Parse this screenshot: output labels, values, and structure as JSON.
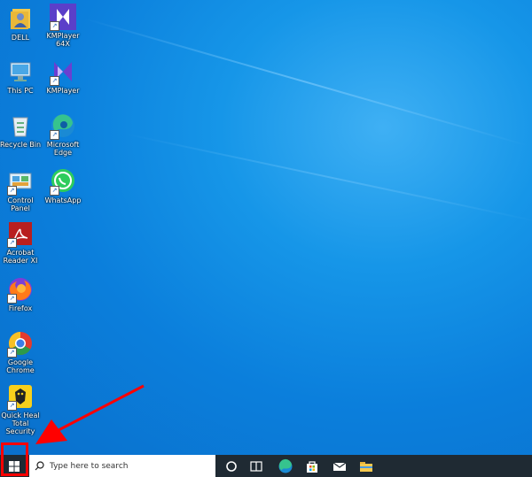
{
  "desktop": {
    "icons": [
      {
        "label": "DELL",
        "icon": "user-folder-icon"
      },
      {
        "label": "KMPlayer 64X",
        "icon": "kmplayer-icon"
      },
      {
        "label": "This PC",
        "icon": "computer-icon"
      },
      {
        "label": "KMPlayer",
        "icon": "kmplayer-icon"
      },
      {
        "label": "Recycle Bin",
        "icon": "recycle-bin-icon"
      },
      {
        "label": "Microsoft Edge",
        "icon": "edge-icon"
      },
      {
        "label": "Control Panel",
        "icon": "control-panel-icon"
      },
      {
        "label": "WhatsApp",
        "icon": "whatsapp-icon"
      },
      {
        "label": "Acrobat Reader XI",
        "icon": "acrobat-icon"
      },
      {
        "label": "Firefox",
        "icon": "firefox-icon"
      },
      {
        "label": "Google Chrome",
        "icon": "chrome-icon"
      },
      {
        "label": "Quick Heal Total Security",
        "icon": "quickheal-icon"
      }
    ]
  },
  "taskbar": {
    "search_placeholder": "Type here to search",
    "pinned": [
      "task-view-icon",
      "edge-icon",
      "store-icon",
      "mail-icon",
      "file-explorer-icon"
    ]
  },
  "annotation": {
    "color": "#ff0000",
    "target": "start-button"
  }
}
